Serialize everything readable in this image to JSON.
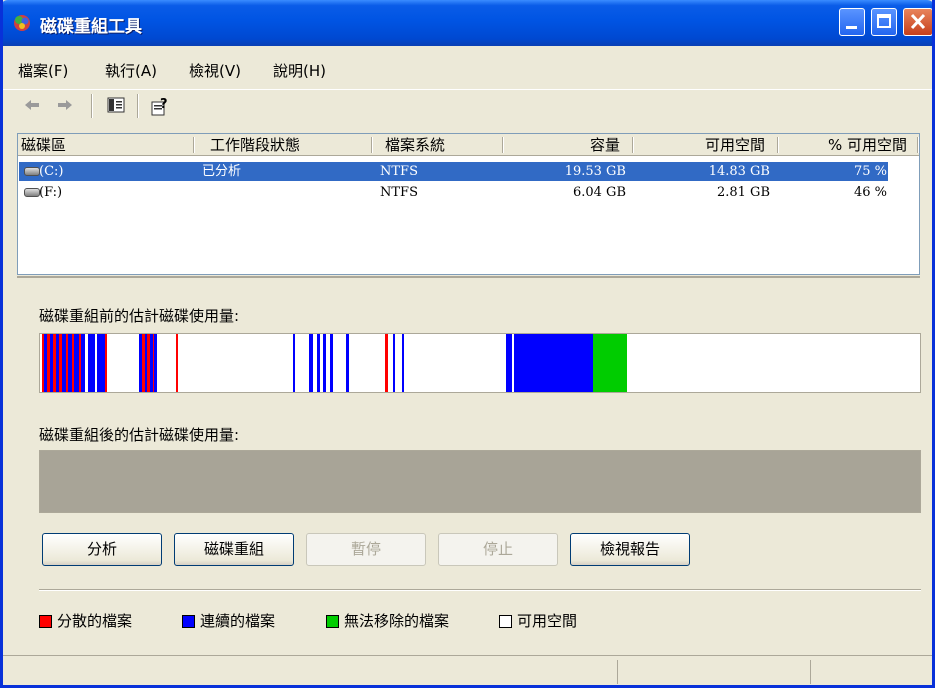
{
  "window": {
    "title": "磁碟重組工具"
  },
  "menu": [
    "檔案(F)",
    "執行(A)",
    "檢視(V)",
    "說明(H)"
  ],
  "columns": [
    "磁碟區",
    "工作階段狀態",
    "檔案系統",
    "容量",
    "可用空間",
    "% 可用空間"
  ],
  "volumes": [
    {
      "name": "(C:)",
      "status": "已分析",
      "fs": "NTFS",
      "capacity": "19.53 GB",
      "free": "14.83 GB",
      "pct": "75 %",
      "selected": true
    },
    {
      "name": "(F:)",
      "status": "",
      "fs": "NTFS",
      "capacity": "6.04 GB",
      "free": "2.81 GB",
      "pct": "46 %",
      "selected": false
    }
  ],
  "before_label": "磁碟重組前的估計磁碟使用量:",
  "after_label": "磁碟重組後的估計磁碟使用量:",
  "buttons": {
    "analyze": "分析",
    "defragment": "磁碟重組",
    "pause": "暫停",
    "stop": "停止",
    "view_report": "檢視報告"
  },
  "legend": [
    {
      "label": "分散的檔案",
      "color": "#ff0000"
    },
    {
      "label": "連續的檔案",
      "color": "#0000ff"
    },
    {
      "label": "無法移除的檔案",
      "color": "#00cc00"
    },
    {
      "label": "可用空間",
      "color": "#ffffff"
    }
  ],
  "usage_before": [
    {
      "kind": "fragmented",
      "start": 0.2,
      "end": 0.5
    },
    {
      "kind": "contiguous",
      "start": 0.5,
      "end": 0.8
    },
    {
      "kind": "fragmented",
      "start": 0.8,
      "end": 1.1
    },
    {
      "kind": "contiguous",
      "start": 1.1,
      "end": 1.5
    },
    {
      "kind": "fragmented",
      "start": 1.5,
      "end": 1.8
    },
    {
      "kind": "contiguous",
      "start": 1.8,
      "end": 2.2
    },
    {
      "kind": "fragmented",
      "start": 2.2,
      "end": 2.5
    },
    {
      "kind": "contiguous",
      "start": 2.5,
      "end": 2.9
    },
    {
      "kind": "fragmented",
      "start": 2.9,
      "end": 3.2
    },
    {
      "kind": "contiguous",
      "start": 3.2,
      "end": 3.6
    },
    {
      "kind": "fragmented",
      "start": 3.6,
      "end": 3.9
    },
    {
      "kind": "contiguous",
      "start": 3.9,
      "end": 4.4
    },
    {
      "kind": "fragmented",
      "start": 4.4,
      "end": 4.7
    },
    {
      "kind": "contiguous",
      "start": 4.7,
      "end": 5.1
    },
    {
      "kind": "contiguous",
      "start": 5.4,
      "end": 6.3
    },
    {
      "kind": "contiguous",
      "start": 6.5,
      "end": 7.4
    },
    {
      "kind": "fragmented",
      "start": 7.4,
      "end": 7.6
    },
    {
      "kind": "contiguous",
      "start": 11.3,
      "end": 11.6
    },
    {
      "kind": "fragmented",
      "start": 11.6,
      "end": 11.9
    },
    {
      "kind": "contiguous",
      "start": 11.9,
      "end": 12.2
    },
    {
      "kind": "fragmented",
      "start": 12.2,
      "end": 12.5
    },
    {
      "kind": "contiguous",
      "start": 12.5,
      "end": 12.8
    },
    {
      "kind": "fragmented",
      "start": 12.8,
      "end": 13.0
    },
    {
      "kind": "contiguous",
      "start": 13.0,
      "end": 13.3
    },
    {
      "kind": "fragmented",
      "start": 15.5,
      "end": 15.7
    },
    {
      "kind": "contiguous",
      "start": 28.7,
      "end": 29.0
    },
    {
      "kind": "contiguous",
      "start": 30.6,
      "end": 31.0
    },
    {
      "kind": "contiguous",
      "start": 31.5,
      "end": 31.8
    },
    {
      "kind": "contiguous",
      "start": 32.2,
      "end": 32.5
    },
    {
      "kind": "contiguous",
      "start": 33.0,
      "end": 33.3
    },
    {
      "kind": "contiguous",
      "start": 34.8,
      "end": 35.1
    },
    {
      "kind": "fragmented",
      "start": 39.2,
      "end": 39.5
    },
    {
      "kind": "contiguous",
      "start": 40.1,
      "end": 40.3
    },
    {
      "kind": "contiguous",
      "start": 41.1,
      "end": 41.4
    },
    {
      "kind": "contiguous",
      "start": 52.9,
      "end": 53.6
    },
    {
      "kind": "contiguous",
      "start": 53.9,
      "end": 62.8
    },
    {
      "kind": "unmovable",
      "start": 62.8,
      "end": 66.7
    }
  ]
}
